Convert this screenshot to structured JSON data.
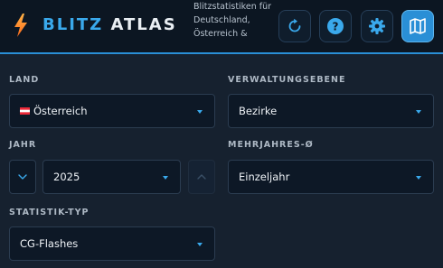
{
  "app": {
    "brand_part1": "BLITZ",
    "brand_part2": "ATLAS",
    "tagline": "Blitzstatistiken für Deutschland, Österreich &",
    "accent_color": "#3aa9ec"
  },
  "header_buttons": [
    {
      "icon": "refresh-icon"
    },
    {
      "icon": "help-icon",
      "label": "?"
    },
    {
      "icon": "gear-icon"
    },
    {
      "icon": "map-icon"
    }
  ],
  "form": {
    "country": {
      "label": "LAND",
      "value": "Österreich",
      "flag": "austria-flag"
    },
    "admin_level": {
      "label": "VERWALTUNGSEBENE",
      "value": "Bezirke"
    },
    "year": {
      "label": "JAHR",
      "value": "2025"
    },
    "multi_year": {
      "label": "MEHRJAHRES-Ø",
      "value": "Einzeljahr"
    },
    "stat_type": {
      "label": "STATISTIK-TYP",
      "value": "CG-Flashes"
    }
  }
}
